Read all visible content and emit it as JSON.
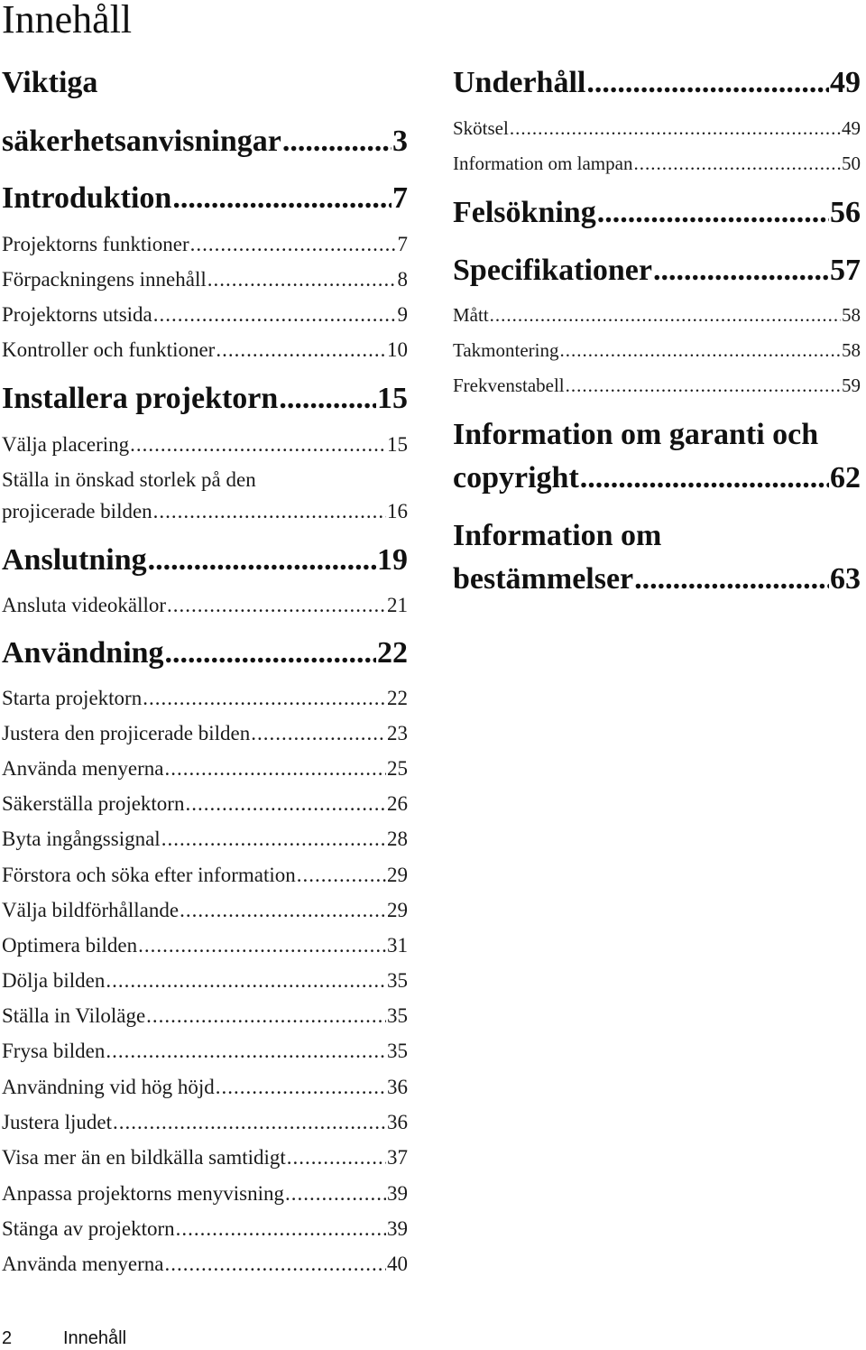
{
  "page": {
    "title": "Innehåll",
    "footer": {
      "page_number": "2",
      "section": "Innehåll"
    }
  },
  "toc": {
    "left": [
      {
        "level": 1,
        "label_line1": "Viktiga",
        "label": "säkerhetsanvisningar",
        "page": "3"
      },
      {
        "level": 1,
        "label": "Introduktion",
        "page": "7"
      },
      {
        "level": 2,
        "label": "Projektorns funktioner",
        "page": "7"
      },
      {
        "level": 2,
        "label": "Förpackningens innehåll",
        "page": "8"
      },
      {
        "level": 2,
        "label": "Projektorns utsida",
        "page": "9"
      },
      {
        "level": 2,
        "label": "Kontroller och funktioner",
        "page": "10"
      },
      {
        "level": 1,
        "label": "Installera projektorn",
        "page": "15"
      },
      {
        "level": 2,
        "label": "Välja placering",
        "page": "15"
      },
      {
        "level": 2,
        "label_line1": "Ställa in önskad storlek på den",
        "label": "projicerade bilden",
        "page": "16"
      },
      {
        "level": 1,
        "label": "Anslutning",
        "page": "19"
      },
      {
        "level": 2,
        "label": "Ansluta videokällor",
        "page": "21"
      },
      {
        "level": 1,
        "label": "Användning",
        "page": "22"
      },
      {
        "level": 2,
        "label": "Starta projektorn",
        "page": "22"
      },
      {
        "level": 2,
        "label": "Justera den projicerade bilden",
        "page": "23"
      },
      {
        "level": 2,
        "label": "Använda menyerna",
        "page": "25"
      },
      {
        "level": 2,
        "label": "Säkerställa projektorn",
        "page": "26"
      },
      {
        "level": 2,
        "label": "Byta ingångssignal",
        "page": "28"
      },
      {
        "level": 2,
        "label": "Förstora och söka efter information",
        "page": "29"
      },
      {
        "level": 2,
        "label": "Välja bildförhållande",
        "page": "29"
      },
      {
        "level": 2,
        "label": "Optimera bilden",
        "page": "31"
      },
      {
        "level": 2,
        "label": "Dölja bilden",
        "page": "35"
      },
      {
        "level": 2,
        "label": "Ställa in Viloläge",
        "page": "35"
      },
      {
        "level": 2,
        "label": "Frysa bilden",
        "page": "35"
      },
      {
        "level": 2,
        "label": "Användning vid hög höjd",
        "page": "36"
      },
      {
        "level": 2,
        "label": "Justera ljudet",
        "page": "36"
      },
      {
        "level": 2,
        "label": "Visa mer än en bildkälla samtidigt",
        "page": "37"
      },
      {
        "level": 2,
        "label": "Anpassa projektorns menyvisning",
        "page": "39"
      },
      {
        "level": 2,
        "label": "Stänga av projektorn",
        "page": "39"
      },
      {
        "level": 2,
        "label": "Använda menyerna",
        "page": "40"
      }
    ],
    "right": [
      {
        "level": 1,
        "label": "Underhåll",
        "page": "49"
      },
      {
        "level": 2,
        "label": "Skötsel",
        "page": "49"
      },
      {
        "level": 2,
        "label": "Information om lampan",
        "page": "50"
      },
      {
        "level": 1,
        "label": "Felsökning",
        "page": "56"
      },
      {
        "level": 1,
        "label": "Specifikationer",
        "page": "57"
      },
      {
        "level": 2,
        "label": "Mått",
        "page": "58"
      },
      {
        "level": 2,
        "label": "Takmontering",
        "page": "58"
      },
      {
        "level": 2,
        "label": "Frekvenstabell",
        "page": "59"
      },
      {
        "level": 1,
        "label_line1": "Information om garanti och",
        "label": "copyright",
        "page": "62"
      },
      {
        "level": 1,
        "label_line1": "Information om",
        "label": "bestämmelser",
        "page": "63"
      }
    ]
  }
}
